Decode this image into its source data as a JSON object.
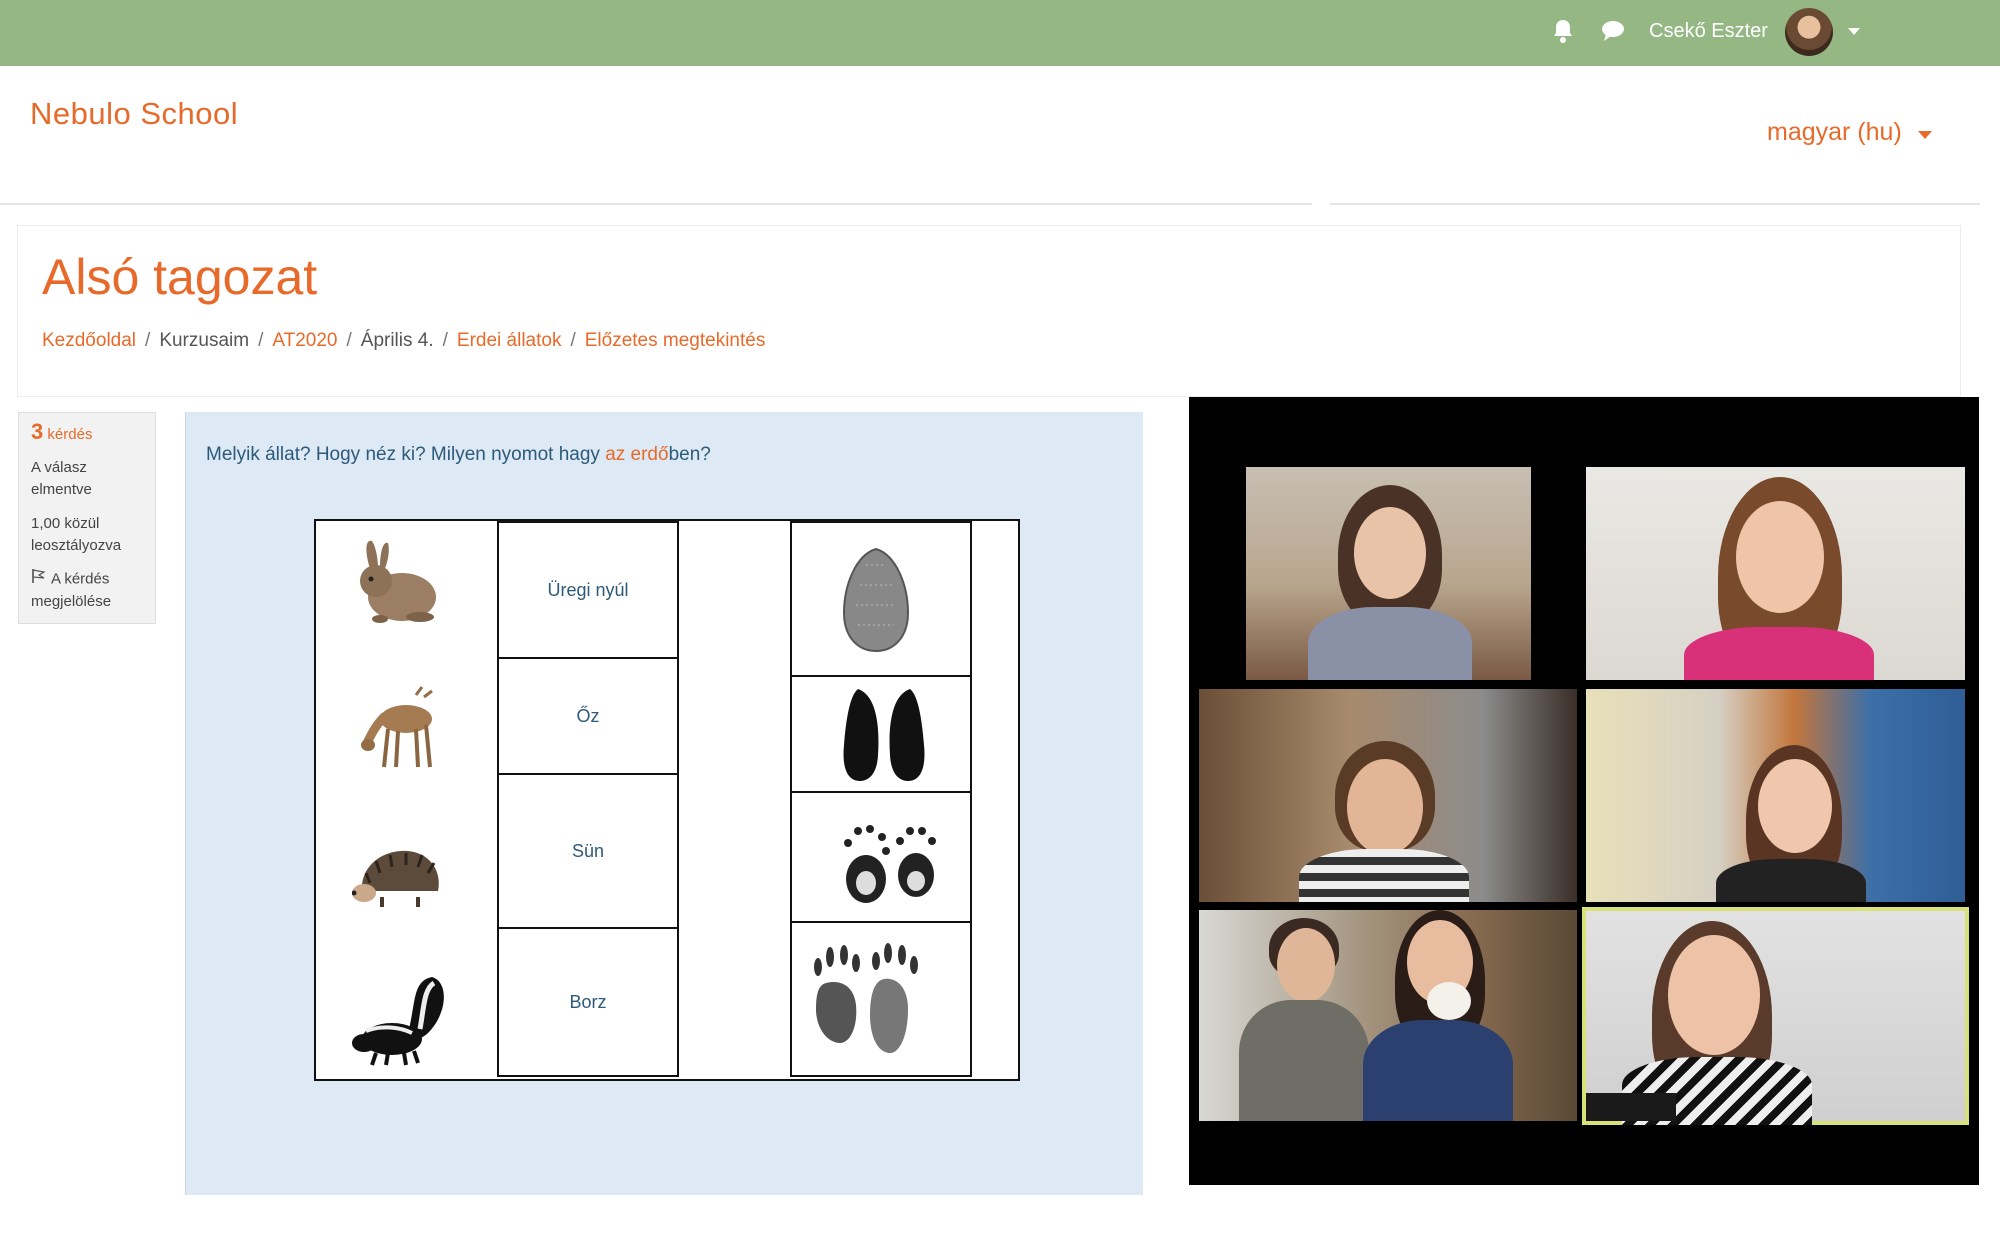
{
  "topbar": {
    "user_name": "Csekő Eszter",
    "icons": [
      "bell-icon",
      "chat-icon",
      "avatar",
      "chevron-down-icon"
    ],
    "bg_color": "#94b784"
  },
  "header": {
    "site_name": "Nebulo School",
    "language": "magyar (hu)",
    "accent_color": "#e86a2a"
  },
  "page": {
    "title": "Alsó tagozat",
    "breadcrumb": [
      {
        "label": "Kezdőoldal",
        "link": true
      },
      {
        "label": "Kurzusaim",
        "link": false
      },
      {
        "label": "AT2020",
        "link": true
      },
      {
        "label": "Április 4.",
        "link": false
      },
      {
        "label": "Erdei állatok",
        "link": true
      },
      {
        "label": "Előzetes megtekintés",
        "link": true
      }
    ]
  },
  "question_info": {
    "number": "3",
    "number_label": "kérdés",
    "status": "A válasz elmentve",
    "grade": "1,00 közül leosztályozva",
    "flag": "A kérdés megjelölése"
  },
  "question": {
    "text_before": "Melyik állat? Hogy néz ki? Milyen nyomot hagy ",
    "text_highlight_1": "az erdő",
    "text_after": "ben?",
    "rows": [
      {
        "animal_icon": "rabbit-icon",
        "name": "Üregi nyúl",
        "track_icon": "rabbit-track-icon"
      },
      {
        "animal_icon": "deer-icon",
        "name": "Őz",
        "track_icon": "deer-hoof-track-icon"
      },
      {
        "animal_icon": "hedgehog-icon",
        "name": "Sün",
        "track_icon": "hedgehog-track-icon"
      },
      {
        "animal_icon": "skunk-icon",
        "name": "Borz",
        "track_icon": "badger-track-icon"
      }
    ]
  },
  "video_call": {
    "participants": 6,
    "active_speaker_color": "#d8e27a"
  }
}
